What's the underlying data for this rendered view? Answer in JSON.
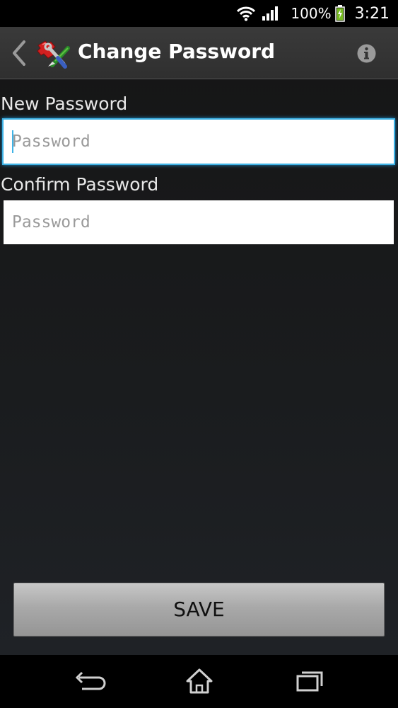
{
  "status_bar": {
    "battery_percent": "100%",
    "time": "3:21",
    "icons": [
      "wifi-icon",
      "signal-icon",
      "battery-charging-icon"
    ]
  },
  "action_bar": {
    "title": "Change Password",
    "icons": [
      "back-chevron-icon",
      "app-tools-icon",
      "info-icon"
    ]
  },
  "form": {
    "new_password": {
      "label": "New Password",
      "placeholder": "Password",
      "value": ""
    },
    "confirm_password": {
      "label": "Confirm Password",
      "placeholder": "Password",
      "value": ""
    }
  },
  "save_label": "SAVE",
  "nav_bar": {
    "icons": [
      "back-icon",
      "home-icon",
      "recent-apps-icon"
    ]
  },
  "colors": {
    "focus_accent": "#3fb3e6",
    "background": "#1a1c1e",
    "action_bar": "#333333"
  }
}
